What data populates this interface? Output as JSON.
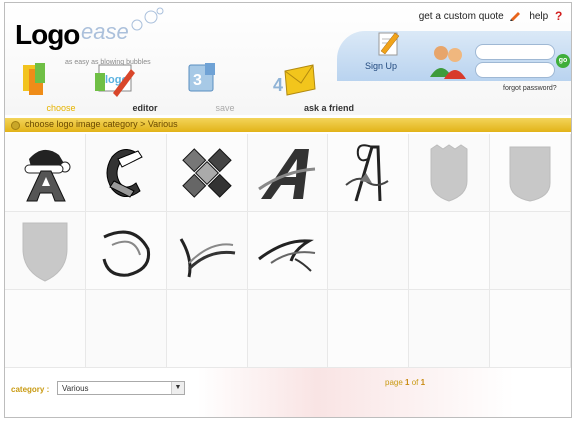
{
  "header": {
    "logo_part_1": "Logo",
    "logo_part_2": "ease",
    "tagline": "as easy as blowing bubbles",
    "custom_quote": "get a custom quote",
    "help": "help",
    "signup_label": "Sign Up",
    "forgot_password": "forgot password?",
    "go_label": "go"
  },
  "tools": [
    {
      "label": "choose"
    },
    {
      "label": "editor"
    },
    {
      "label": "save"
    },
    {
      "label": "ask a friend"
    }
  ],
  "breadcrumb": "choose logo image category > Various",
  "grid_icons": [
    "santa-hat-a-icon",
    "ribbon-c-icon",
    "puzzle-cross-icon",
    "stylized-a-icon",
    "ornate-a-icon",
    "shield-shape-icon",
    "rounded-shield-icon",
    "pointed-shield-icon",
    "swoosh-ring-icon",
    "wing-swoosh-icon",
    "double-swoosh-icon",
    "",
    "",
    ""
  ],
  "footer": {
    "category_label": "category :",
    "category_value": "Various",
    "page_label": "page",
    "page_current": "1",
    "page_of": "of",
    "page_total": "1"
  },
  "colors": {
    "category_bar": "#e2b319",
    "accent_gold": "#c99a12",
    "go_button": "#3fae3a"
  }
}
